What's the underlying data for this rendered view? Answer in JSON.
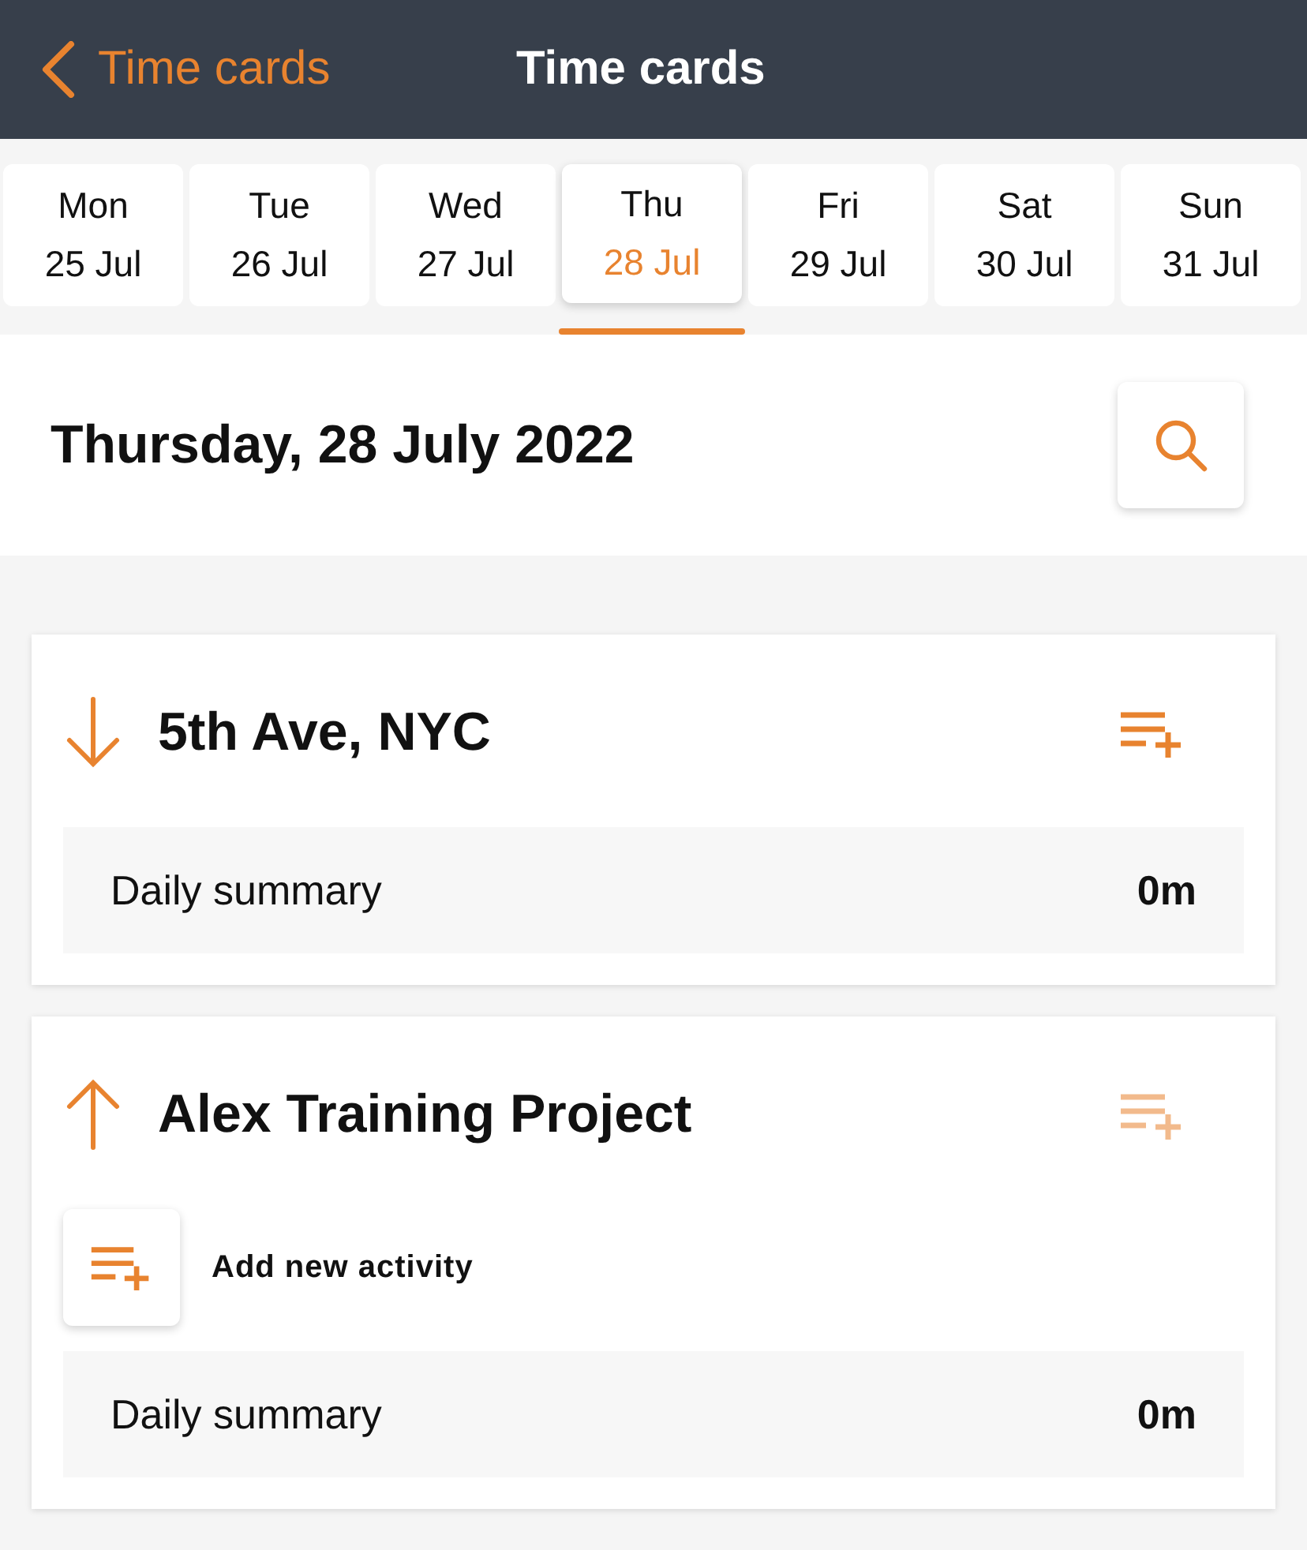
{
  "header": {
    "back_label": "Time cards",
    "title": "Time cards"
  },
  "days": [
    {
      "weekday": "Mon",
      "date": "25 Jul",
      "selected": false
    },
    {
      "weekday": "Tue",
      "date": "26 Jul",
      "selected": false
    },
    {
      "weekday": "Wed",
      "date": "27 Jul",
      "selected": false
    },
    {
      "weekday": "Thu",
      "date": "28 Jul",
      "selected": true
    },
    {
      "weekday": "Fri",
      "date": "29 Jul",
      "selected": false
    },
    {
      "weekday": "Sat",
      "date": "30 Jul",
      "selected": false
    },
    {
      "weekday": "Sun",
      "date": "31 Jul",
      "selected": false
    }
  ],
  "date_title": "Thursday, 28 July 2022",
  "projects": [
    {
      "name": "5th Ave, NYC",
      "expanded": false,
      "summary_label": "Daily summary",
      "summary_value": "0m"
    },
    {
      "name": "Alex Training Project",
      "expanded": true,
      "add_activity_label": "Add new activity",
      "summary_label": "Daily summary",
      "summary_value": "0m"
    }
  ]
}
